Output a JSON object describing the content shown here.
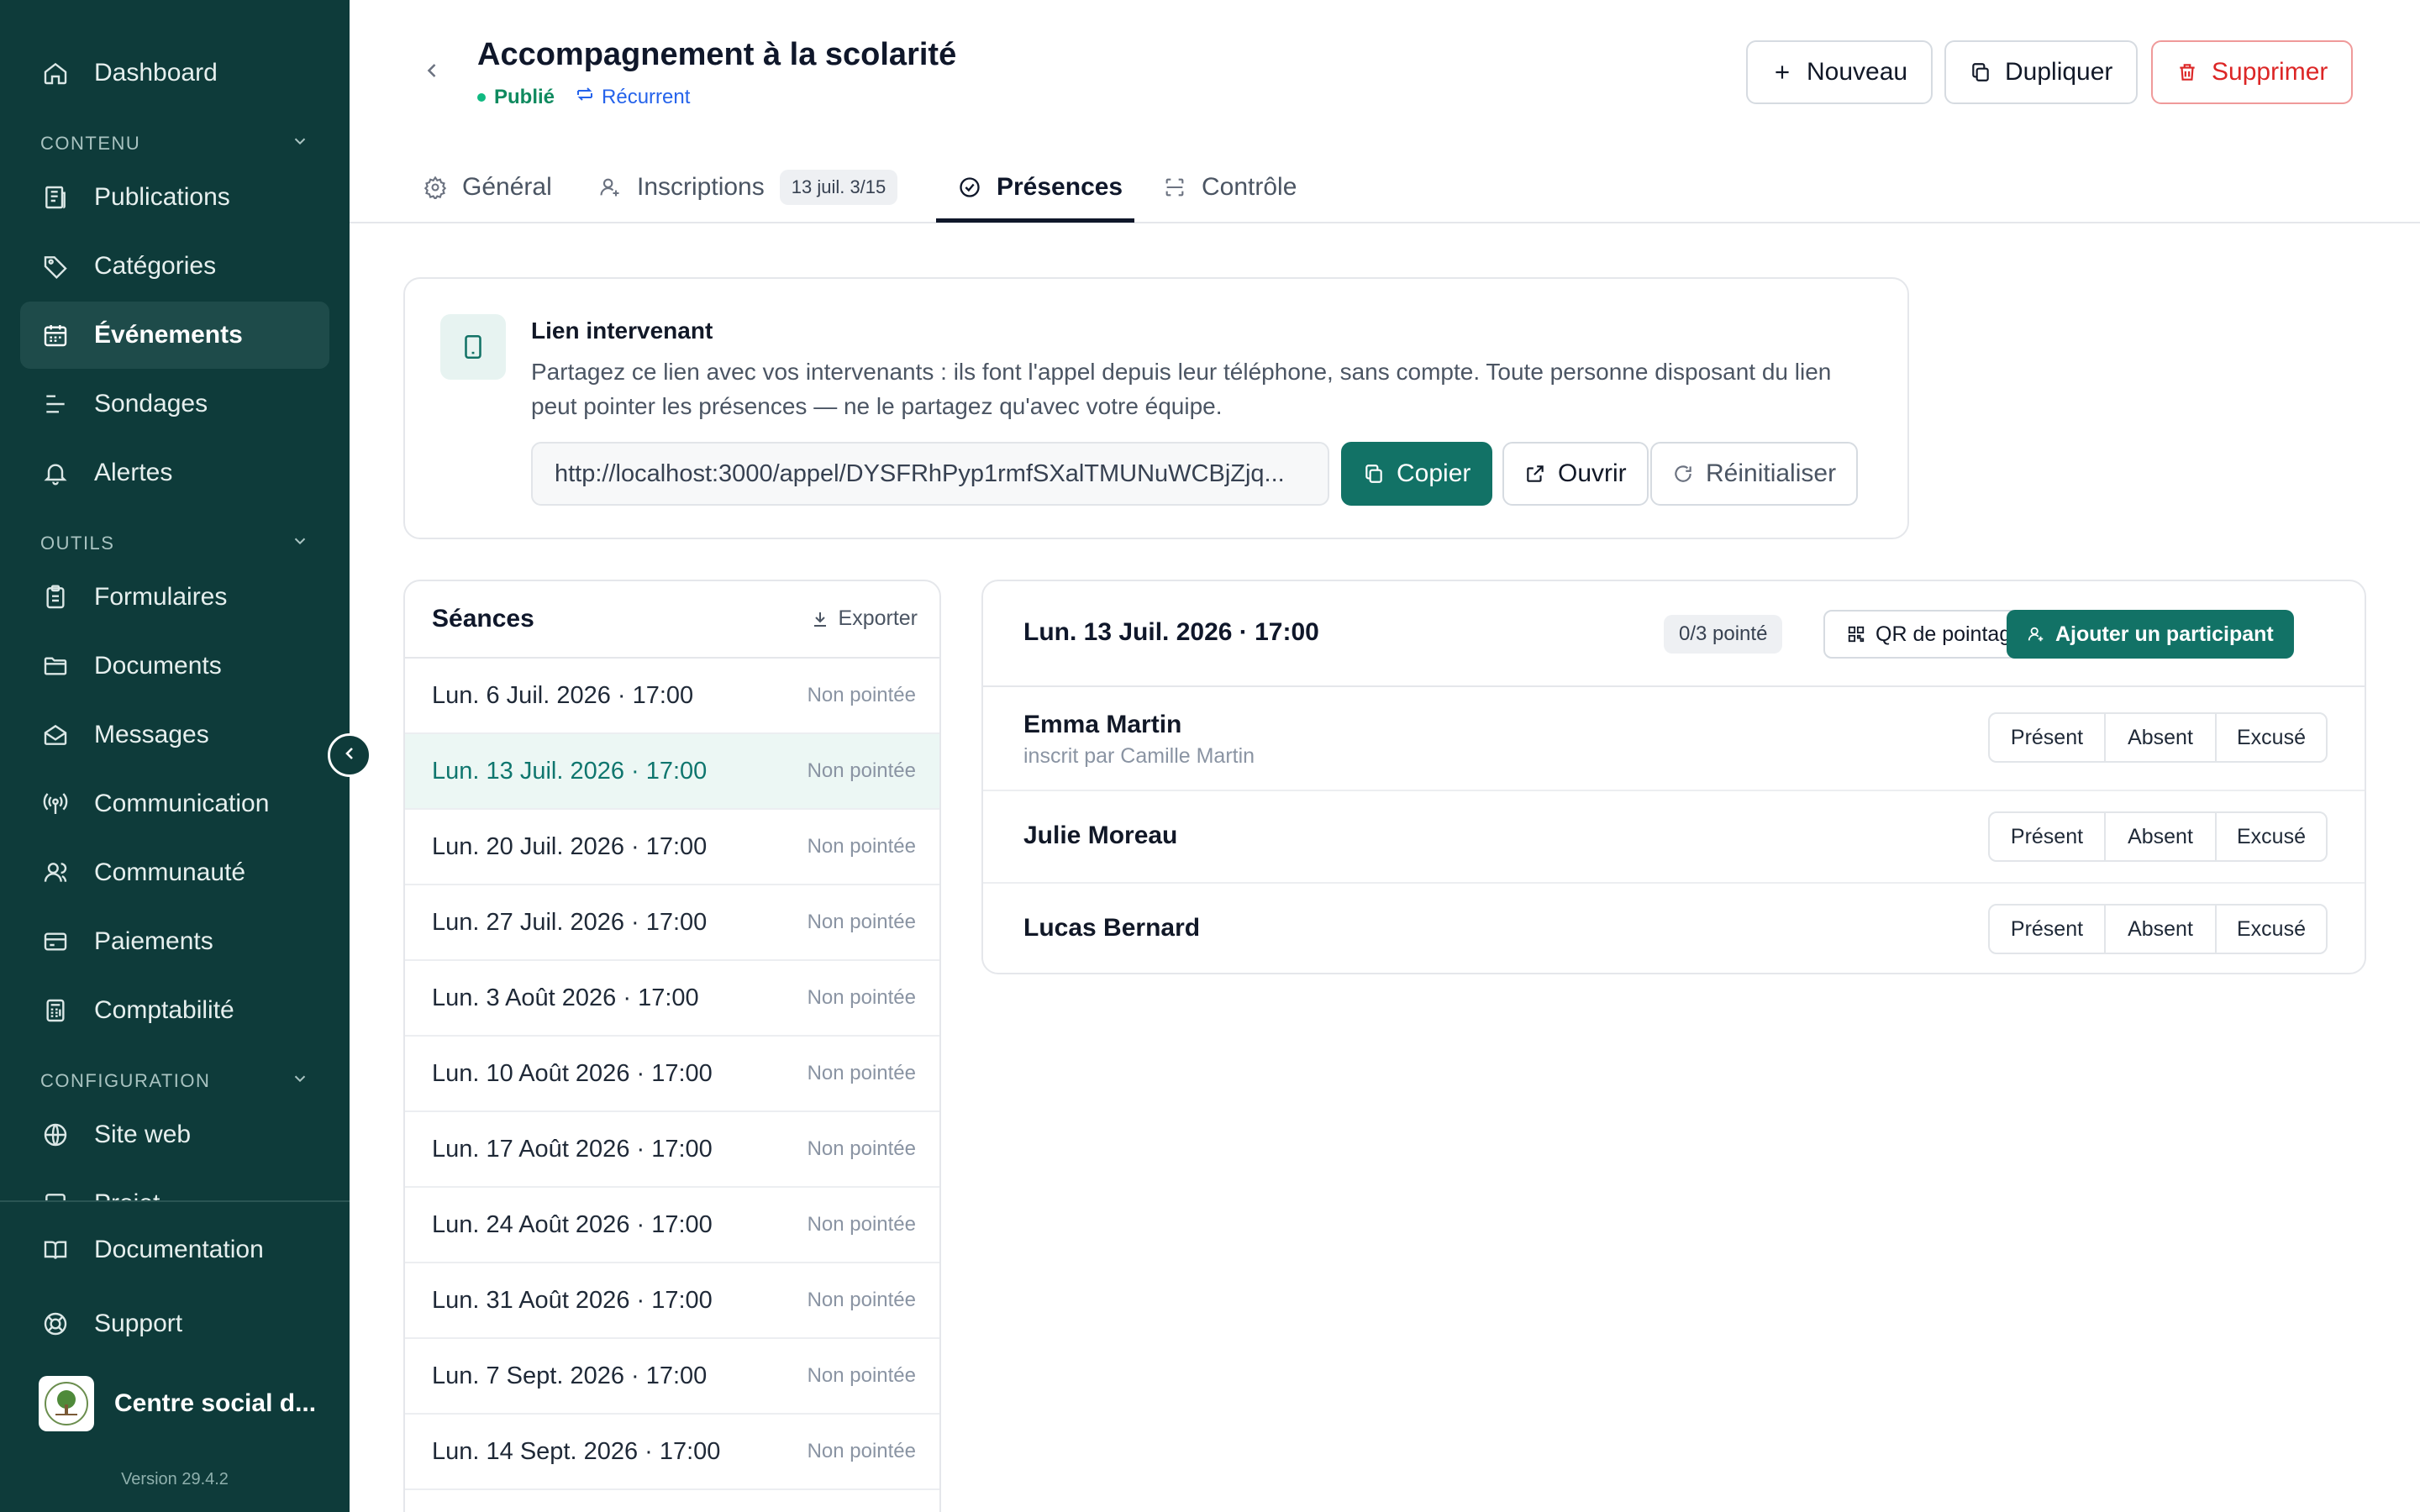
{
  "sidebar": {
    "top_item": {
      "label": "Dashboard",
      "icon": "home-icon"
    },
    "sections": [
      {
        "title": "CONTENU",
        "items": [
          {
            "label": "Publications",
            "icon": "newspaper-icon"
          },
          {
            "label": "Catégories",
            "icon": "tag-icon"
          },
          {
            "label": "Événements",
            "icon": "calendar-icon",
            "active": true
          },
          {
            "label": "Sondages",
            "icon": "poll-icon"
          },
          {
            "label": "Alertes",
            "icon": "bell-icon"
          }
        ]
      },
      {
        "title": "OUTILS",
        "items": [
          {
            "label": "Formulaires",
            "icon": "clipboard-icon"
          },
          {
            "label": "Documents",
            "icon": "folder-icon"
          },
          {
            "label": "Messages",
            "icon": "mail-icon"
          },
          {
            "label": "Communication",
            "icon": "broadcast-icon"
          },
          {
            "label": "Communauté",
            "icon": "users-icon"
          },
          {
            "label": "Paiements",
            "icon": "card-icon"
          },
          {
            "label": "Comptabilité",
            "icon": "calculator-icon"
          }
        ]
      },
      {
        "title": "CONFIGURATION",
        "items": [
          {
            "label": "Site web",
            "icon": "globe-icon"
          },
          {
            "label": "Projet",
            "icon": "project-icon"
          }
        ]
      }
    ],
    "bottom_items": [
      {
        "label": "Documentation",
        "icon": "book-icon"
      },
      {
        "label": "Support",
        "icon": "lifebuoy-icon"
      }
    ],
    "org_name": "Centre social d...",
    "version": "Version 29.4.2"
  },
  "header": {
    "title": "Accompagnement à la scolarité",
    "status": "Publié",
    "recurrence": "Récurrent",
    "buttons": {
      "new": "Nouveau",
      "duplicate": "Dupliquer",
      "delete": "Supprimer"
    }
  },
  "tabs": [
    {
      "label": "Général",
      "icon": "gear-icon"
    },
    {
      "label": "Inscriptions",
      "icon": "user-plus-icon",
      "badge": "13 juil. 3/15"
    },
    {
      "label": "Présences",
      "icon": "check-circle-icon",
      "active": true
    },
    {
      "label": "Contrôle",
      "icon": "scan-icon"
    }
  ],
  "link_card": {
    "title": "Lien intervenant",
    "description": "Partagez ce lien avec vos intervenants : ils font l'appel depuis leur téléphone, sans compte. Toute personne disposant du lien peut pointer les présences — ne le partagez qu'avec votre équipe.",
    "url": "http://localhost:3000/appel/DYSFRhPyp1rmfSXalTMUNuWCBjZjq...",
    "copy": "Copier",
    "open": "Ouvrir",
    "reset": "Réinitialiser"
  },
  "sessions": {
    "title": "Séances",
    "export": "Exporter",
    "items": [
      {
        "date": "Lun. 6 Juil. 2026 · 17:00",
        "status": "Non pointée"
      },
      {
        "date": "Lun. 13 Juil. 2026 · 17:00",
        "status": "Non pointée",
        "active": true
      },
      {
        "date": "Lun. 20 Juil. 2026 · 17:00",
        "status": "Non pointée"
      },
      {
        "date": "Lun. 27 Juil. 2026 · 17:00",
        "status": "Non pointée"
      },
      {
        "date": "Lun. 3 Août 2026 · 17:00",
        "status": "Non pointée"
      },
      {
        "date": "Lun. 10 Août 2026 · 17:00",
        "status": "Non pointée"
      },
      {
        "date": "Lun. 17 Août 2026 · 17:00",
        "status": "Non pointée"
      },
      {
        "date": "Lun. 24 Août 2026 · 17:00",
        "status": "Non pointée"
      },
      {
        "date": "Lun. 31 Août 2026 · 17:00",
        "status": "Non pointée"
      },
      {
        "date": "Lun. 7 Sept. 2026 · 17:00",
        "status": "Non pointée"
      },
      {
        "date": "Lun. 14 Sept. 2026 · 17:00",
        "status": "Non pointée"
      }
    ]
  },
  "detail": {
    "title": "Lun. 13 Juil. 2026 · 17:00",
    "pointe": "0/3 pointé",
    "qr": "QR de pointage",
    "add": "Ajouter un participant",
    "options": [
      "Présent",
      "Absent",
      "Excusé"
    ],
    "participants": [
      {
        "name": "Emma Martin",
        "sub": "inscrit par Camille Martin"
      },
      {
        "name": "Julie Moreau",
        "sub": ""
      },
      {
        "name": "Lucas Bernard",
        "sub": ""
      }
    ]
  },
  "colors": {
    "sidebar_bg": "#0e3b3a",
    "accent": "#127266",
    "danger": "#dc2626",
    "published": "#0f8a5f",
    "recurrent": "#2563eb"
  }
}
